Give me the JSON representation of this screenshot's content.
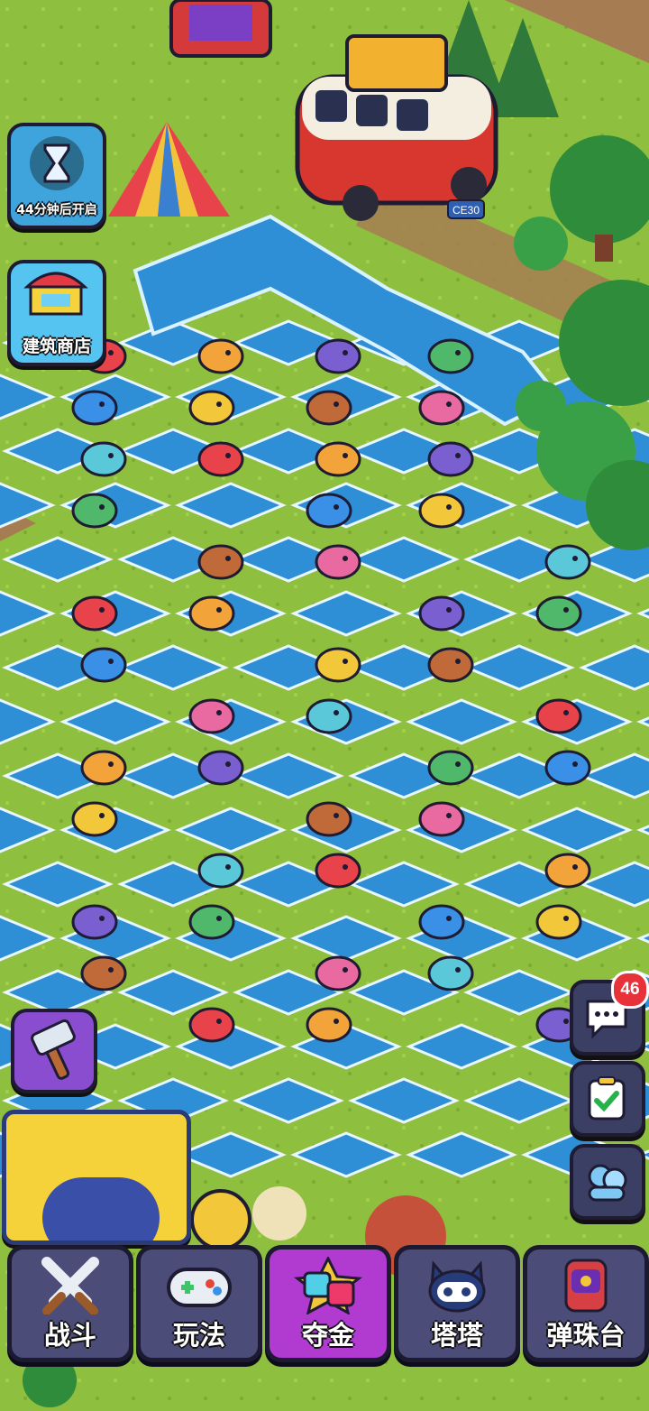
{
  "event_timer": {
    "label": "44分钟后开启",
    "icon": "hourglass-icon"
  },
  "building_shop": {
    "label": "建筑商店",
    "icon": "shop-icon"
  },
  "hammer_tool": {
    "icon": "hammer-icon"
  },
  "chat_button": {
    "icon": "chat-bubble-icon",
    "badge": "46"
  },
  "tasks_button": {
    "icon": "clipboard-check-icon"
  },
  "friends_button": {
    "icon": "friends-icon"
  },
  "van": {
    "plate": "CE30"
  },
  "nav_tabs": [
    {
      "label": "战斗",
      "icon": "crossed-swords-icon",
      "active": false
    },
    {
      "label": "玩法",
      "icon": "gamepad-icon",
      "active": false
    },
    {
      "label": "夺金",
      "icon": "gold-rush-icon",
      "active": true
    },
    {
      "label": "塔塔",
      "icon": "robot-cat-icon",
      "active": false
    },
    {
      "label": "弹珠台",
      "icon": "pinball-icon",
      "active": false
    }
  ],
  "colors": {
    "grass": "#8fbf3e",
    "water": "#2f8fd6",
    "nav_bg": "#4b4c78",
    "nav_active": "#b13ad1",
    "badge": "#e8323a"
  }
}
